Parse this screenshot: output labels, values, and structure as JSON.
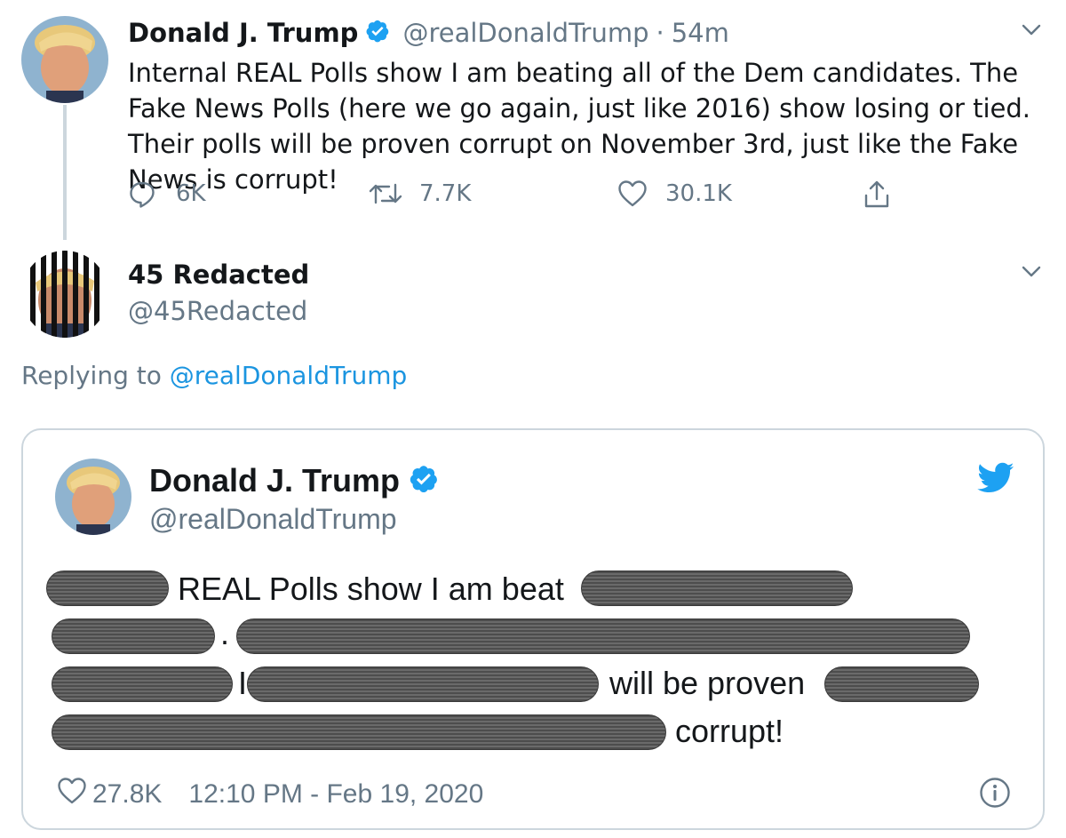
{
  "tweet": {
    "author_name": "Donald J. Trump",
    "author_handle": "@realDonaldTrump",
    "separator": "·",
    "time_ago": "54m",
    "text": "Internal REAL Polls show I am beating all of the Dem candidates. The Fake News Polls (here we go again, just like 2016) show losing or tied. Their polls will be proven corrupt on November 3rd, just like the Fake News is corrupt!",
    "actions": {
      "replies": "6K",
      "retweets": "7.7K",
      "likes": "30.1K"
    }
  },
  "reply": {
    "author_name": "45 Redacted",
    "author_handle": "@45Redacted",
    "replying_prefix": "Replying to",
    "replying_mention": "@realDonaldTrump"
  },
  "embedded": {
    "author_name": "Donald J. Trump",
    "author_handle": "@realDonaldTrump",
    "visible_fragments": [
      "REAL Polls show I am beat",
      ".",
      "I",
      "will be proven",
      "corrupt!"
    ],
    "likes": "27.8K",
    "timestamp": "12:10 PM - Feb 19, 2020"
  },
  "icons": {
    "verified": "verified-badge-icon",
    "chevron": "chevron-down-icon",
    "reply": "reply-icon",
    "retweet": "retweet-icon",
    "like": "heart-icon",
    "share": "share-icon",
    "twitter": "twitter-bird-icon",
    "info": "info-icon"
  },
  "colors": {
    "text": "#14171a",
    "secondary": "#657786",
    "accent": "#1da1f2",
    "link": "#1b95e0",
    "border": "#ccd6dd"
  }
}
